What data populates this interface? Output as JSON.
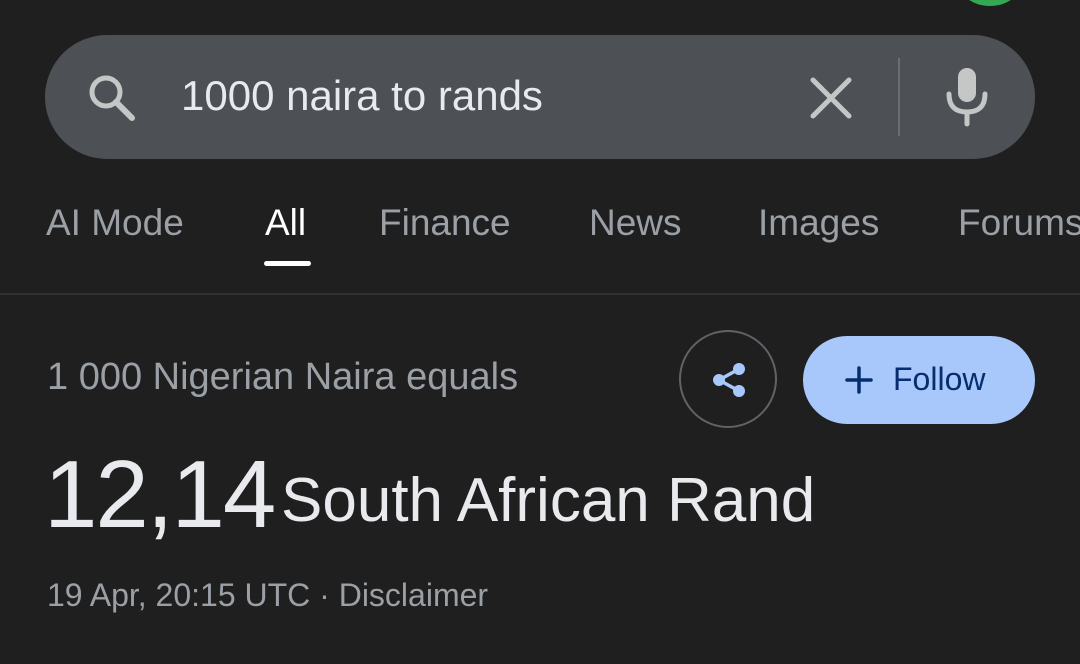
{
  "search": {
    "query": "1000 naira to rands"
  },
  "tabs": [
    {
      "label": "AI Mode"
    },
    {
      "label": "All"
    },
    {
      "label": "Finance"
    },
    {
      "label": "News"
    },
    {
      "label": "Images"
    },
    {
      "label": "Forums"
    }
  ],
  "active_tab": "All",
  "conversion": {
    "from_text": "1 000 Nigerian Naira equals",
    "result_value": "12,14",
    "result_currency": "South African Rand",
    "timestamp": "19 Apr, 20:15 UTC",
    "separator": "·",
    "disclaimer_label": "Disclaimer"
  },
  "actions": {
    "follow_label": "Follow"
  },
  "icons": {
    "search": "search-icon",
    "clear": "close-icon",
    "mic": "microphone-icon",
    "share": "share-icon",
    "follow": "plus-icon"
  },
  "colors": {
    "background": "#1f1f1f",
    "search_bar": "#4d5156",
    "follow_button": "#a8c7fa",
    "follow_text": "#062e6f",
    "share_icon": "#a8c7fa",
    "avatar": "#34a853"
  }
}
